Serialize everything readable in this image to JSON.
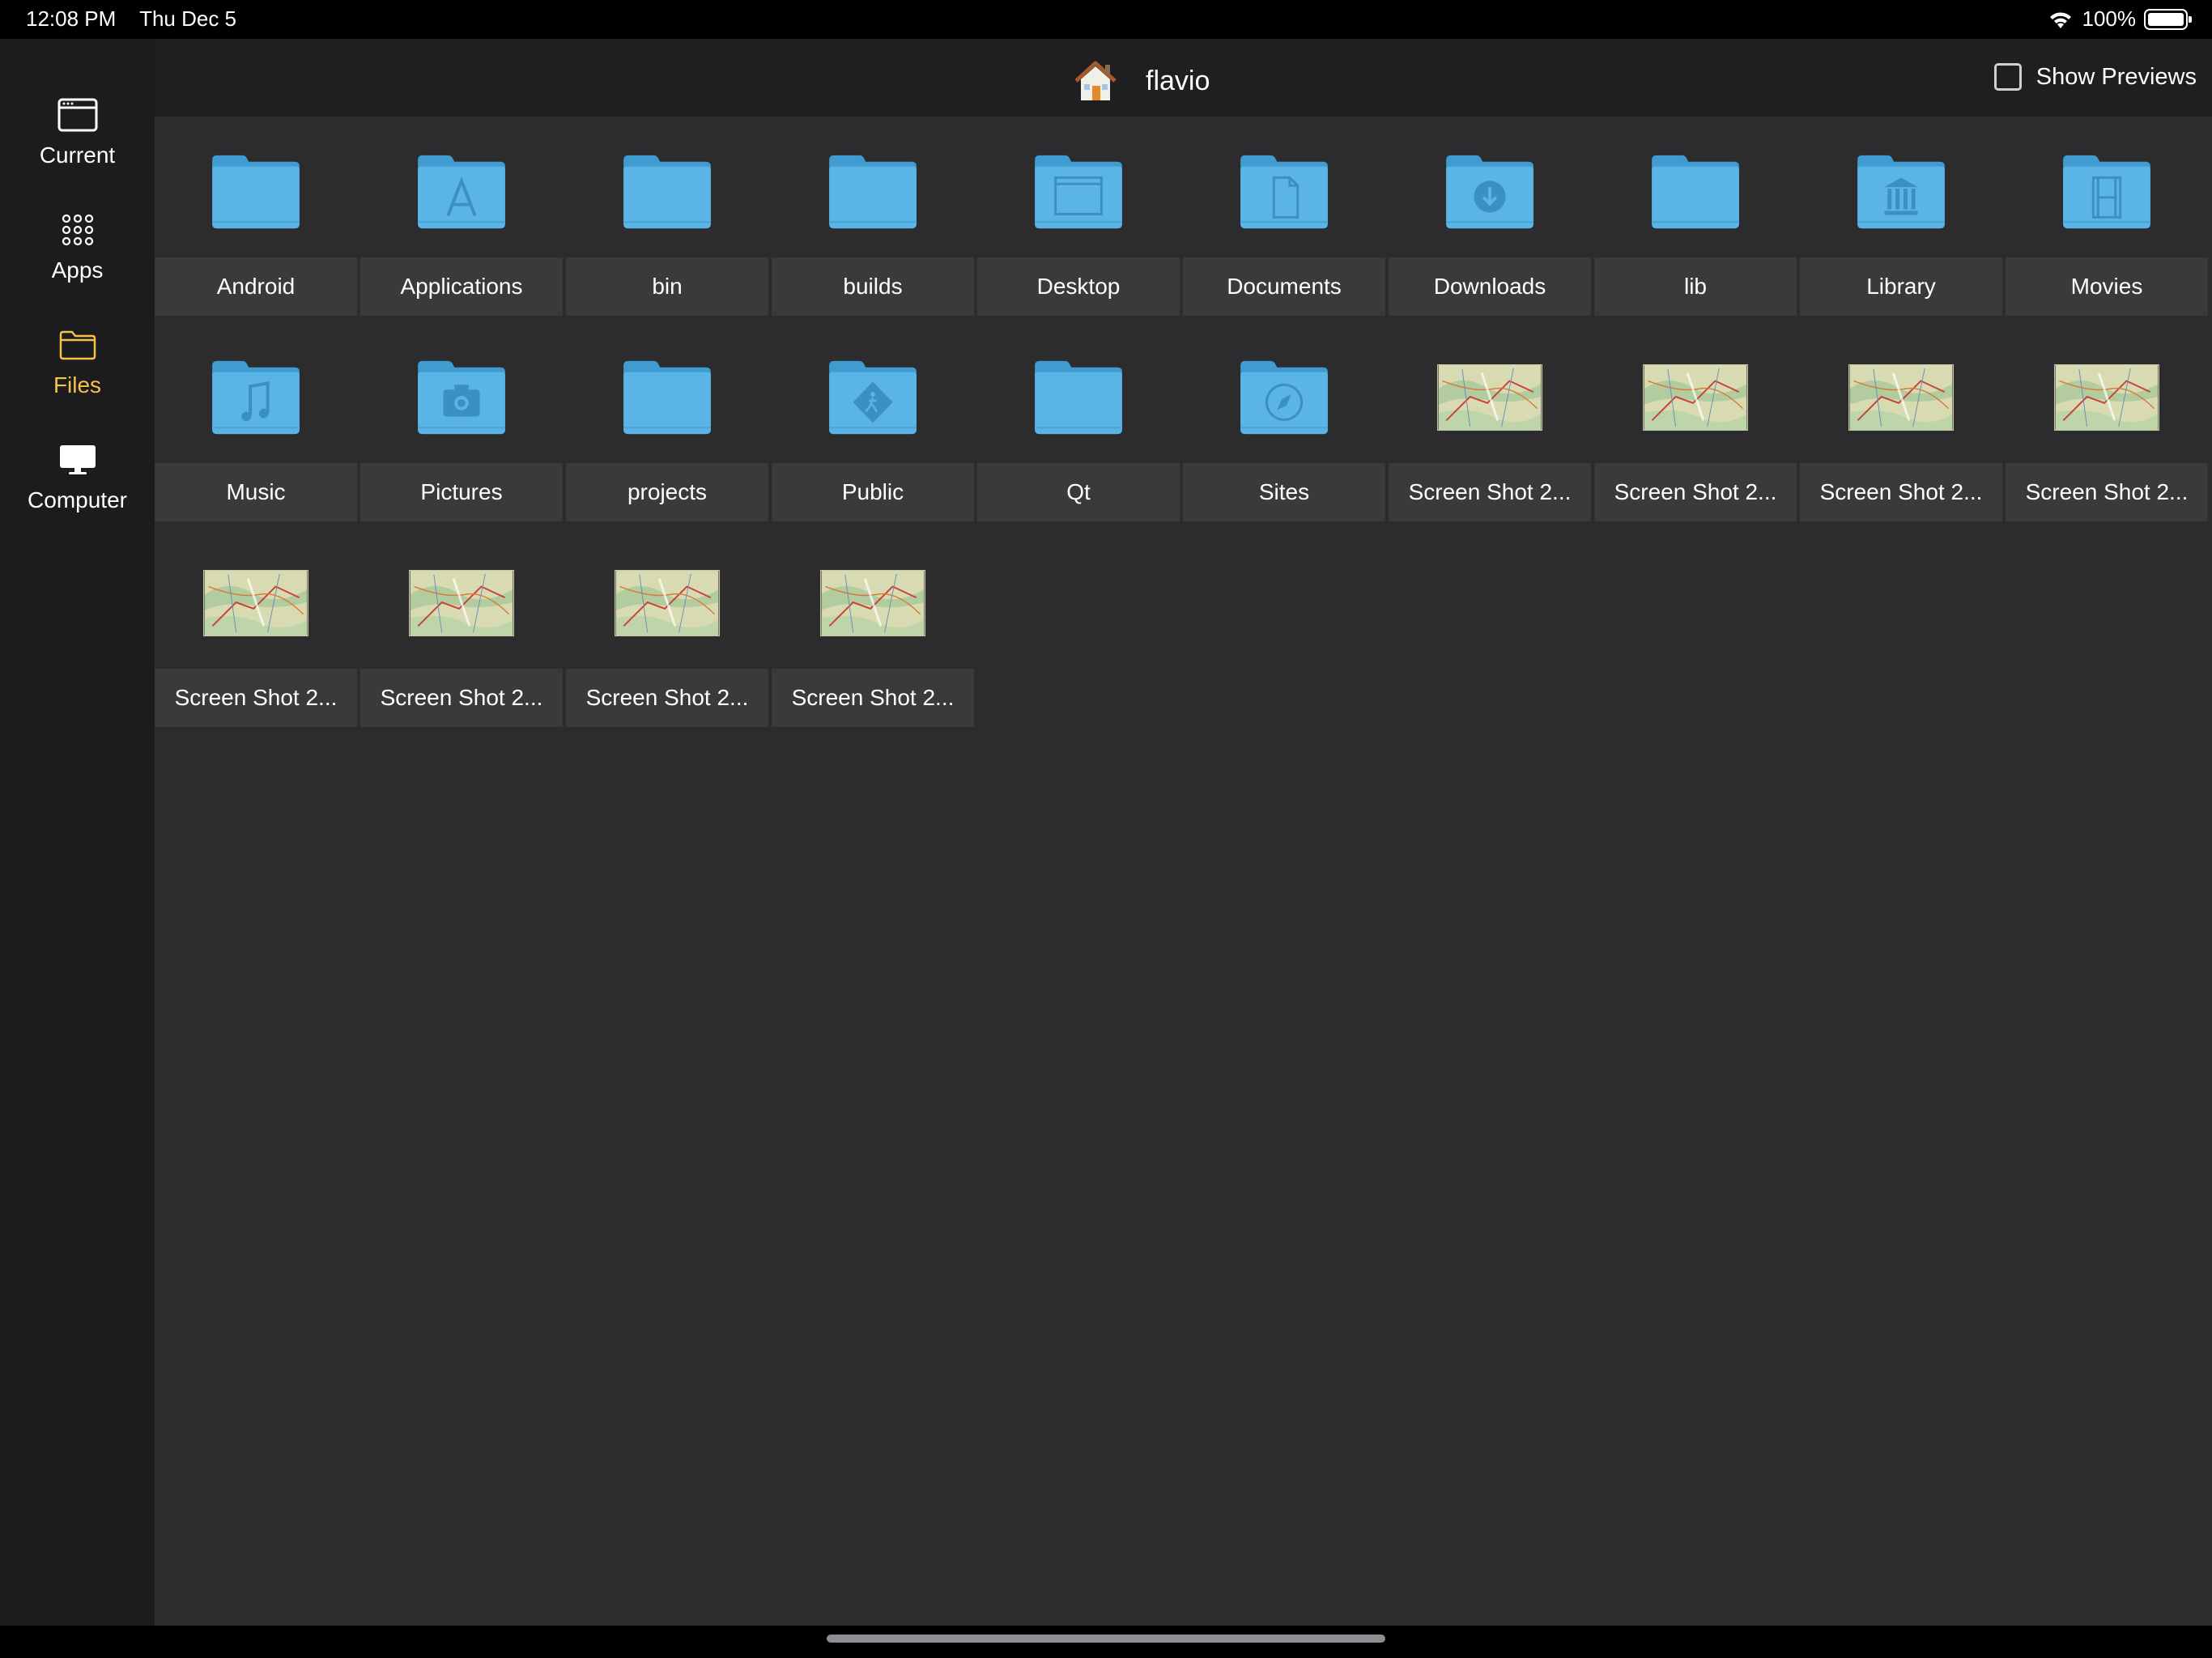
{
  "status": {
    "time": "12:08 PM",
    "date": "Thu Dec 5",
    "battery": "100%"
  },
  "sidebar": {
    "items": [
      {
        "label": "Current",
        "icon": "window-icon",
        "active": false
      },
      {
        "label": "Apps",
        "icon": "apps-grid-icon",
        "active": false
      },
      {
        "label": "Files",
        "icon": "folder-icon",
        "active": true
      },
      {
        "label": "Computer",
        "icon": "monitor-icon",
        "active": false
      }
    ],
    "active_color": "#f6c14a"
  },
  "header": {
    "title": "flavio",
    "show_previews_label": "Show Previews",
    "show_previews_checked": false
  },
  "files": [
    {
      "name": "Android",
      "type": "folder",
      "icon": "folder-icon"
    },
    {
      "name": "Applications",
      "type": "folder",
      "icon": "applications-folder-icon"
    },
    {
      "name": "bin",
      "type": "folder",
      "icon": "folder-icon"
    },
    {
      "name": "builds",
      "type": "folder",
      "icon": "folder-icon"
    },
    {
      "name": "Desktop",
      "type": "folder",
      "icon": "desktop-folder-icon"
    },
    {
      "name": "Documents",
      "type": "folder",
      "icon": "documents-folder-icon"
    },
    {
      "name": "Downloads",
      "type": "folder",
      "icon": "downloads-folder-icon"
    },
    {
      "name": "lib",
      "type": "folder",
      "icon": "folder-icon"
    },
    {
      "name": "Library",
      "type": "folder",
      "icon": "library-folder-icon"
    },
    {
      "name": "Movies",
      "type": "folder",
      "icon": "movies-folder-icon"
    },
    {
      "name": "Music",
      "type": "folder",
      "icon": "music-folder-icon"
    },
    {
      "name": "Pictures",
      "type": "folder",
      "icon": "pictures-folder-icon"
    },
    {
      "name": "projects",
      "type": "folder",
      "icon": "folder-icon"
    },
    {
      "name": "Public",
      "type": "folder",
      "icon": "public-folder-icon"
    },
    {
      "name": "Qt",
      "type": "folder",
      "icon": "folder-icon"
    },
    {
      "name": "Sites",
      "type": "folder",
      "icon": "sites-folder-icon"
    },
    {
      "name": "Screen Shot 2...",
      "type": "image",
      "icon": "map-thumbnail-icon"
    },
    {
      "name": "Screen Shot 2...",
      "type": "image",
      "icon": "map-thumbnail-icon"
    },
    {
      "name": "Screen Shot 2...",
      "type": "image",
      "icon": "map-thumbnail-icon"
    },
    {
      "name": "Screen Shot 2...",
      "type": "image",
      "icon": "map-thumbnail-icon"
    },
    {
      "name": "Screen Shot 2...",
      "type": "image",
      "icon": "map-thumbnail-icon"
    },
    {
      "name": "Screen Shot 2...",
      "type": "image",
      "icon": "map-thumbnail-icon"
    },
    {
      "name": "Screen Shot 2...",
      "type": "image",
      "icon": "map-thumbnail-icon"
    },
    {
      "name": "Screen Shot 2...",
      "type": "image",
      "icon": "map-thumbnail-icon"
    }
  ],
  "colors": {
    "folder": "#5ab4e5",
    "folder_dark": "#3f9bd0",
    "background": "#2c2c2e",
    "label_background": "#3a3a3c"
  }
}
